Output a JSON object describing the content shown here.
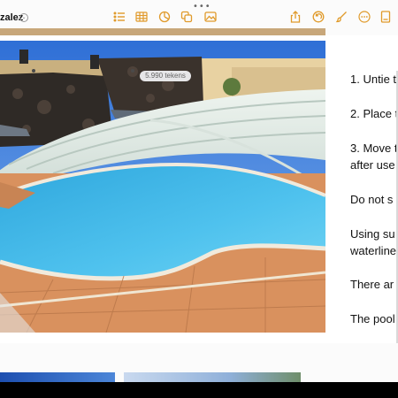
{
  "window": {
    "handle_dots": "•••"
  },
  "document": {
    "title_fragment": "zalez",
    "title_chevron": "⌄"
  },
  "toolbar": {
    "left_icons": [
      "list-icon",
      "table-icon",
      "chart-icon",
      "shapes-icon",
      "media-icon"
    ],
    "right_icons": [
      "share-icon",
      "undo-icon",
      "brush-icon",
      "more-icon",
      "document-icon"
    ]
  },
  "word_count_badge": "5.990 tekens",
  "text_lines": [
    "1. Untie t",
    "2. Place t",
    "3. Move t",
    "after use",
    "Do not s",
    "Using su",
    "waterline",
    "There ar",
    "The pool"
  ],
  "colors": {
    "accent": "#e09a2a",
    "toolbar_bg": "#fbfbfb",
    "text": "#111111"
  }
}
